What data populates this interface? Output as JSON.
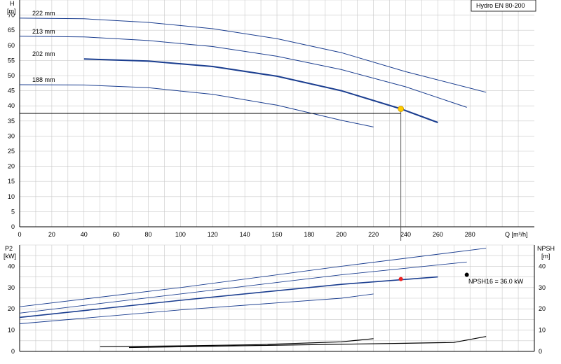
{
  "chart_data": [
    {
      "type": "line",
      "title": "Hydro EN 80-200",
      "ylabel_top": "H",
      "ylabel_unit": "[m]",
      "xlabel": "Q [m³/h]",
      "xlim": [
        0,
        320
      ],
      "ylim": [
        0,
        75
      ],
      "x_ticks": [
        "0",
        "20",
        "40",
        "60",
        "80",
        "100",
        "120",
        "140",
        "160",
        "180",
        "200",
        "220",
        "240",
        "260",
        "280"
      ],
      "y_ticks": [
        "0",
        "5",
        "10",
        "15",
        "20",
        "25",
        "30",
        "35",
        "40",
        "45",
        "50",
        "55",
        "60",
        "65",
        "70"
      ],
      "grid": true,
      "series": [
        {
          "name": "222 mm",
          "x": [
            0,
            40,
            80,
            120,
            160,
            200,
            240,
            290
          ],
          "y": [
            69,
            68.8,
            67.6,
            65.5,
            62.2,
            57.6,
            51.3,
            44.5
          ]
        },
        {
          "name": "213 mm",
          "x": [
            0,
            40,
            80,
            120,
            160,
            200,
            240,
            278
          ],
          "y": [
            63,
            62.8,
            61.6,
            59.6,
            56.4,
            52.0,
            46.3,
            39.5
          ]
        },
        {
          "name": "202 mm",
          "x": [
            40,
            80,
            120,
            160,
            200,
            237,
            260
          ],
          "y": [
            55.5,
            54.8,
            53.0,
            49.8,
            45.0,
            39.0,
            34.5
          ],
          "highlight": true
        },
        {
          "name": "188 mm",
          "x": [
            0,
            40,
            80,
            120,
            160,
            200,
            220
          ],
          "y": [
            47,
            46.9,
            46.0,
            43.8,
            40.2,
            35.2,
            33.0
          ]
        }
      ],
      "duty_point": {
        "x": 237,
        "y": 39
      }
    },
    {
      "type": "line",
      "ylabel_left": "P2",
      "ylabel_left_unit": "[kW]",
      "ylabel_right": "NPSH",
      "ylabel_right_unit": "[m]",
      "ylim": [
        0,
        50
      ],
      "y_ticks": [
        "0",
        "10",
        "20",
        "30",
        "40"
      ],
      "grid": true,
      "annotation": "NPSH16 = 36.0 kW",
      "series_p2": [
        {
          "x": [
            0,
            100,
            200,
            290
          ],
          "y": [
            21,
            30,
            40,
            48.5
          ]
        },
        {
          "x": [
            0,
            100,
            200,
            278
          ],
          "y": [
            18,
            27,
            36,
            42
          ]
        },
        {
          "x": [
            0,
            100,
            200,
            260
          ],
          "y": [
            16,
            24,
            31.5,
            35
          ],
          "highlight": true
        },
        {
          "x": [
            0,
            100,
            200,
            220
          ],
          "y": [
            13,
            19.5,
            25,
            27
          ]
        }
      ],
      "series_npsh": [
        {
          "x": [
            50,
            100,
            150,
            200,
            220
          ],
          "y": [
            2.2,
            2.6,
            3.2,
            4.5,
            6
          ]
        },
        {
          "x": [
            68,
            150,
            240,
            270,
            290
          ],
          "y": [
            1.8,
            2.8,
            3.8,
            4.2,
            7
          ]
        }
      ],
      "points": [
        {
          "x": 237,
          "y": 34,
          "color": "#ee2222"
        },
        {
          "x": 278,
          "y": 36,
          "color": "#000000"
        }
      ]
    }
  ],
  "colors": {
    "curve": "#1a3d8f",
    "grid": "#c8c8c8",
    "duty": "#ffcc00"
  }
}
